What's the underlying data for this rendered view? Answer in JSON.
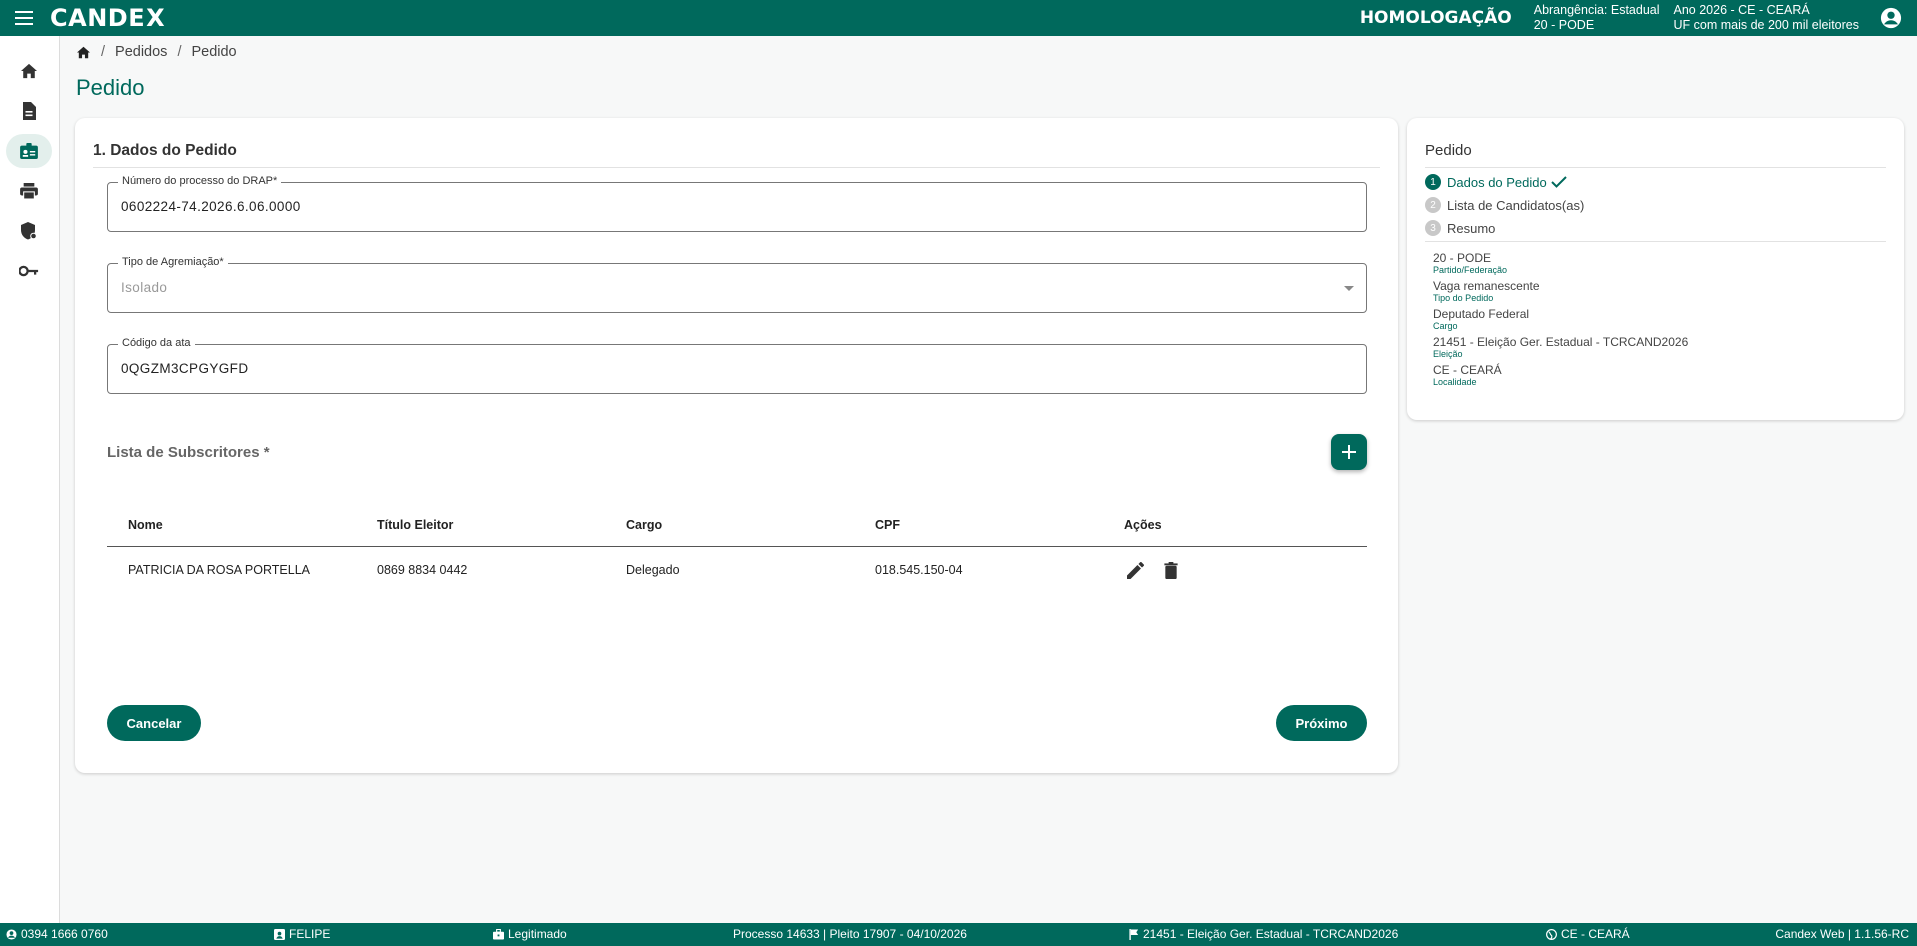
{
  "topbar": {
    "logo": "CANDE",
    "logo_x": "X",
    "environment": "HOMOLOGAÇÃO",
    "scope_line1": "Abrangência: Estadual",
    "scope_line2": "20 - PODE",
    "year_line1": "Ano 2026 - CE - CEARÁ",
    "year_line2": "UF com mais de 200 mil eleitores"
  },
  "sidebar": {
    "items": [
      {
        "icon": "home-icon"
      },
      {
        "icon": "document-icon"
      },
      {
        "icon": "badge-icon"
      },
      {
        "icon": "printer-icon"
      },
      {
        "icon": "shield-icon"
      },
      {
        "icon": "key-icon"
      }
    ]
  },
  "breadcrumb": {
    "items": [
      "Pedidos",
      "Pedido"
    ],
    "separator": "/"
  },
  "page": {
    "title": "Pedido"
  },
  "form": {
    "section_title": "1. Dados do Pedido",
    "fields": [
      {
        "label": "Número do processo do DRAP*",
        "value": "0602224-74.2026.6.06.0000"
      },
      {
        "label": "Tipo de Agremiação*",
        "value": "Isolado"
      },
      {
        "label": "Código da ata",
        "value": "0QGZM3CPGYGFD"
      }
    ],
    "subscribers_title": "Lista de Subscritores *",
    "table": {
      "headers": [
        "Nome",
        "Título Eleitor",
        "Cargo",
        "CPF",
        "Ações"
      ],
      "rows": [
        [
          "PATRICIA DA ROSA PORTELLA",
          "0869 8834 0442",
          "Delegado",
          "018.545.150-04"
        ]
      ]
    },
    "cancel_label": "Cancelar",
    "next_label": "Próximo"
  },
  "side": {
    "title": "Pedido",
    "steps": [
      {
        "num": "1",
        "label": "Dados do Pedido"
      },
      {
        "num": "2",
        "label": "Lista de Candidatos(as)"
      },
      {
        "num": "3",
        "label": "Resumo"
      }
    ],
    "summary": [
      {
        "value": "20 - PODE",
        "label": "Partido/Federação"
      },
      {
        "value": "Vaga remanescente",
        "label": "Tipo do Pedido"
      },
      {
        "value": "Deputado Federal",
        "label": "Cargo"
      },
      {
        "value": "21451 - Eleição Ger. Estadual - TCRCAND2026",
        "label": "Eleição"
      },
      {
        "value": "CE - CEARÁ",
        "label": "Localidade"
      }
    ]
  },
  "footer": {
    "phone": "0394 1666 0760",
    "user": "FELIPE",
    "status": "Legitimado",
    "process": "Processo 14633 | Pleito 17907 - 04/10/2026",
    "election": "21451 - Eleição Ger. Estadual - TCRCAND2026",
    "locality": "CE - CEARÁ",
    "version": "Candex Web | 1.1.56-RC"
  },
  "colors": {
    "primary": "#00695c",
    "active_bg": "#e3efec"
  }
}
